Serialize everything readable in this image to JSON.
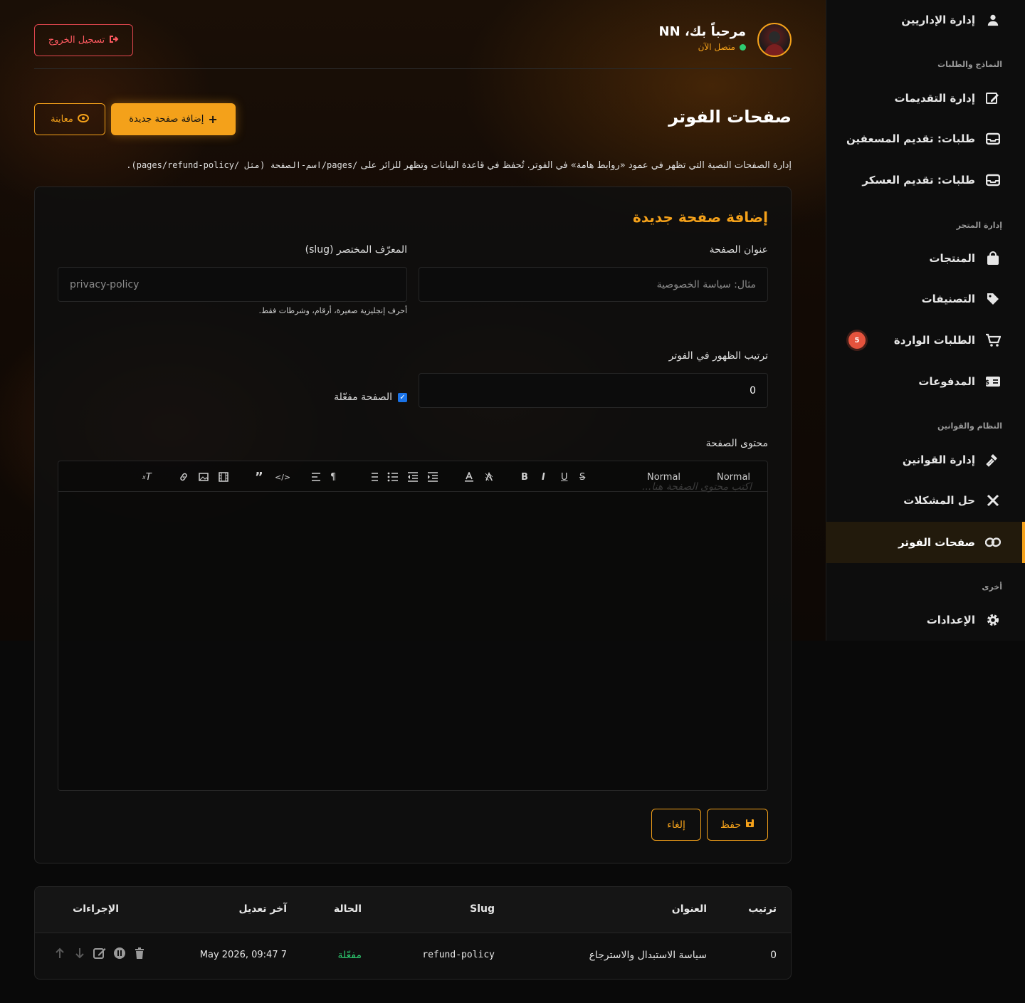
{
  "sidebar": {
    "items": [
      {
        "label": "إدارة الإداريين",
        "icon": "user-icon"
      },
      {
        "label": "إدارة التقديمات",
        "icon": "edit-doc-icon"
      },
      {
        "label": "طلبات: تقديم المسعفين",
        "icon": "inbox-icon"
      },
      {
        "label": "طلبات: تقديم العسكر",
        "icon": "inbox-icon"
      },
      {
        "label": "المنتجات",
        "icon": "bag-icon"
      },
      {
        "label": "التصنيفات",
        "icon": "tag-icon"
      },
      {
        "label": "الطلبات الواردة",
        "icon": "cart-icon",
        "badge": "5"
      },
      {
        "label": "المدفوعات",
        "icon": "money-icon"
      },
      {
        "label": "إدارة القوانين",
        "icon": "gavel-icon"
      },
      {
        "label": "حل المشكلات",
        "icon": "tools-icon"
      },
      {
        "label": "صفحات الفوتر",
        "icon": "link-icon",
        "active": true
      },
      {
        "label": "الإعدادات",
        "icon": "gear-icon"
      }
    ],
    "sections": [
      "النماذج والطلبات",
      "إدارة المتجر",
      "النظام والقوانين",
      "أخرى"
    ]
  },
  "header": {
    "welcome": "مرحباً بك، NN",
    "status": "متصل الآن",
    "logout": "تسجيل الخروج"
  },
  "page": {
    "title": "صفحات الفوتر",
    "add_button": "إضافة صفحة جديدة",
    "preview_button": "معاينة",
    "description_text": "إدارة الصفحات النصية التي تظهر في عمود «روابط هامة» في الفوتر. تُحفظ في قاعدة البيانات وتظهر للزائر على",
    "description_code": "/pages/اسم-الصفحة (مثل /pages/refund-policy)."
  },
  "form": {
    "title": "إضافة صفحة جديدة",
    "title_label": "عنوان الصفحة",
    "title_placeholder": "مثال: سياسة الخصوصية",
    "slug_label": "المعرّف المختصر (slug)",
    "slug_placeholder": "privacy-policy",
    "slug_hint": "أحرف إنجليزية صغيرة، أرقام، وشرطات فقط.",
    "order_label": "ترتيب الظهور في الفوتر",
    "order_value": "0",
    "enabled_label": "الصفحة مفعّلة",
    "content_label": "محتوى الصفحة",
    "editor_placeholder": "اكتب محتوى الصفحة هنا...",
    "toolbar": {
      "header1": "Normal",
      "header2": "Normal"
    },
    "save": "حفظ",
    "cancel": "إلغاء"
  },
  "table": {
    "headers": [
      "ترتيب",
      "العنوان",
      "Slug",
      "الحالة",
      "آخر تعديل",
      "الإجراءات"
    ],
    "rows": [
      {
        "order": "0",
        "title": "سياسة الاستبدال والاسترجاع",
        "slug": "refund-policy",
        "status": "مفعّلة",
        "modified": "May 2026, 09:47 7"
      }
    ]
  },
  "colors": {
    "accent": "#f4a11a",
    "danger": "#e0464e",
    "success": "#2ecc71"
  }
}
